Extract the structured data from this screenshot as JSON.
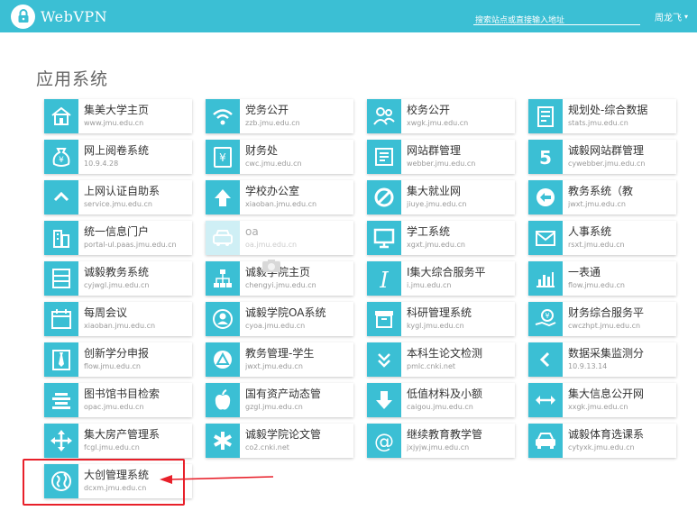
{
  "header": {
    "logo_text": "WebVPN",
    "search_placeholder": "搜索站点或直接输入地址",
    "user_name": "周龙飞",
    "caret": "▾",
    "brand_color": "#3bbfd4"
  },
  "section_title": "应用系统",
  "apps": [
    {
      "name": "集美大学主页",
      "url": "www.jmu.edu.cn",
      "icon": "school-building-icon"
    },
    {
      "name": "党务公开",
      "url": "zzb.jmu.edu.cn",
      "icon": "wifi-icon"
    },
    {
      "name": "校务公开",
      "url": "xwgk.jmu.edu.cn",
      "icon": "people-icon"
    },
    {
      "name": "规划处-综合数据",
      "url": "stats.jmu.edu.cn",
      "icon": "report-icon"
    },
    {
      "name": "网上阅卷系统",
      "url": "10.9.4.28",
      "icon": "money-bag-icon"
    },
    {
      "name": "财务处",
      "url": "cwc.jmu.edu.cn",
      "icon": "yen-document-icon"
    },
    {
      "name": "网站群管理",
      "url": "webber.jmu.edu.cn",
      "icon": "list-panel-icon"
    },
    {
      "name": "诚毅网站群管理",
      "url": "cywebber.jmu.edu.cn",
      "icon": "number-five-icon"
    },
    {
      "name": "上网认证自助系",
      "url": "service.jmu.edu.cn",
      "icon": "chevron-up-icon"
    },
    {
      "name": "学校办公室",
      "url": "xiaoban.jmu.edu.cn",
      "icon": "arrow-up-icon"
    },
    {
      "name": "集大就业网",
      "url": "jiuye.jmu.edu.cn",
      "icon": "ban-icon"
    },
    {
      "name": "教务系统（教",
      "url": "jwxt.jmu.edu.cn",
      "icon": "arrow-left-circle-icon"
    },
    {
      "name": "统一信息门户",
      "url": "portal-ul.paas.jmu.edu.cn",
      "icon": "buildings-icon"
    },
    {
      "name": "oa",
      "url": "oa.jmu.edu.cn",
      "icon": "car-icon",
      "faded": true
    },
    {
      "name": "学工系统",
      "url": "xgxt.jmu.edu.cn",
      "icon": "monitor-icon"
    },
    {
      "name": "人事系统",
      "url": "rsxt.jmu.edu.cn",
      "icon": "envelope-icon"
    },
    {
      "name": "诚毅教务系统",
      "url": "cyjwgl.jmu.edu.cn",
      "icon": "drawers-icon"
    },
    {
      "name": "诚毅学院主页",
      "url": "chengyi.jmu.edu.cn",
      "icon": "org-chart-icon"
    },
    {
      "name": "I集大综合服务平",
      "url": "i.jmu.edu.cn",
      "icon": "letter-i-icon"
    },
    {
      "name": "一表通",
      "url": "flow.jmu.edu.cn",
      "icon": "bar-chart-icon"
    },
    {
      "name": "每周会议",
      "url": "xiaoban.jmu.edu.cn",
      "icon": "calendar-icon"
    },
    {
      "name": "诚毅学院OA系统",
      "url": "cyoa.jmu.edu.cn",
      "icon": "user-circle-icon"
    },
    {
      "name": "科研管理系统",
      "url": "kygl.jmu.edu.cn",
      "icon": "archive-box-icon"
    },
    {
      "name": "财务综合服务平",
      "url": "cwczhpt.jmu.edu.cn",
      "icon": "yen-hand-icon"
    },
    {
      "name": "创新学分申报",
      "url": "flow.jmu.edu.cn",
      "icon": "tie-icon"
    },
    {
      "name": "教务管理-学生",
      "url": "jwxt.jmu.edu.cn",
      "icon": "triangle-circle-icon"
    },
    {
      "name": "本科生论文检测",
      "url": "pmlc.cnki.net",
      "icon": "double-chevron-down-icon"
    },
    {
      "name": "数据采集监测分",
      "url": "10.9.13.14",
      "icon": "chevron-left-icon"
    },
    {
      "name": "图书馆书目检索",
      "url": "opac.jmu.edu.cn",
      "icon": "align-center-icon"
    },
    {
      "name": "国有资产动态管",
      "url": "gzgl.jmu.edu.cn",
      "icon": "apple-icon"
    },
    {
      "name": "低值材料及小额",
      "url": "caigou.jmu.edu.cn",
      "icon": "arrow-down-icon"
    },
    {
      "name": "集大信息公开网",
      "url": "xxgk.jmu.edu.cn",
      "icon": "horizontal-arrows-icon"
    },
    {
      "name": "集大房产管理系",
      "url": "fcgl.jmu.edu.cn",
      "icon": "move-arrows-icon"
    },
    {
      "name": "诚毅学院论文管",
      "url": "co2.cnki.net",
      "icon": "asterisk-icon"
    },
    {
      "name": "继续教育教学管",
      "url": "jxjyjw.jmu.edu.cn",
      "icon": "at-sign-icon"
    },
    {
      "name": "诚毅体育选课系",
      "url": "cytyxk.jmu.edu.cn",
      "icon": "car-front-icon"
    },
    {
      "name": "大创管理系统",
      "url": "dcxm.jmu.edu.cn",
      "icon": "globe-icon"
    }
  ]
}
